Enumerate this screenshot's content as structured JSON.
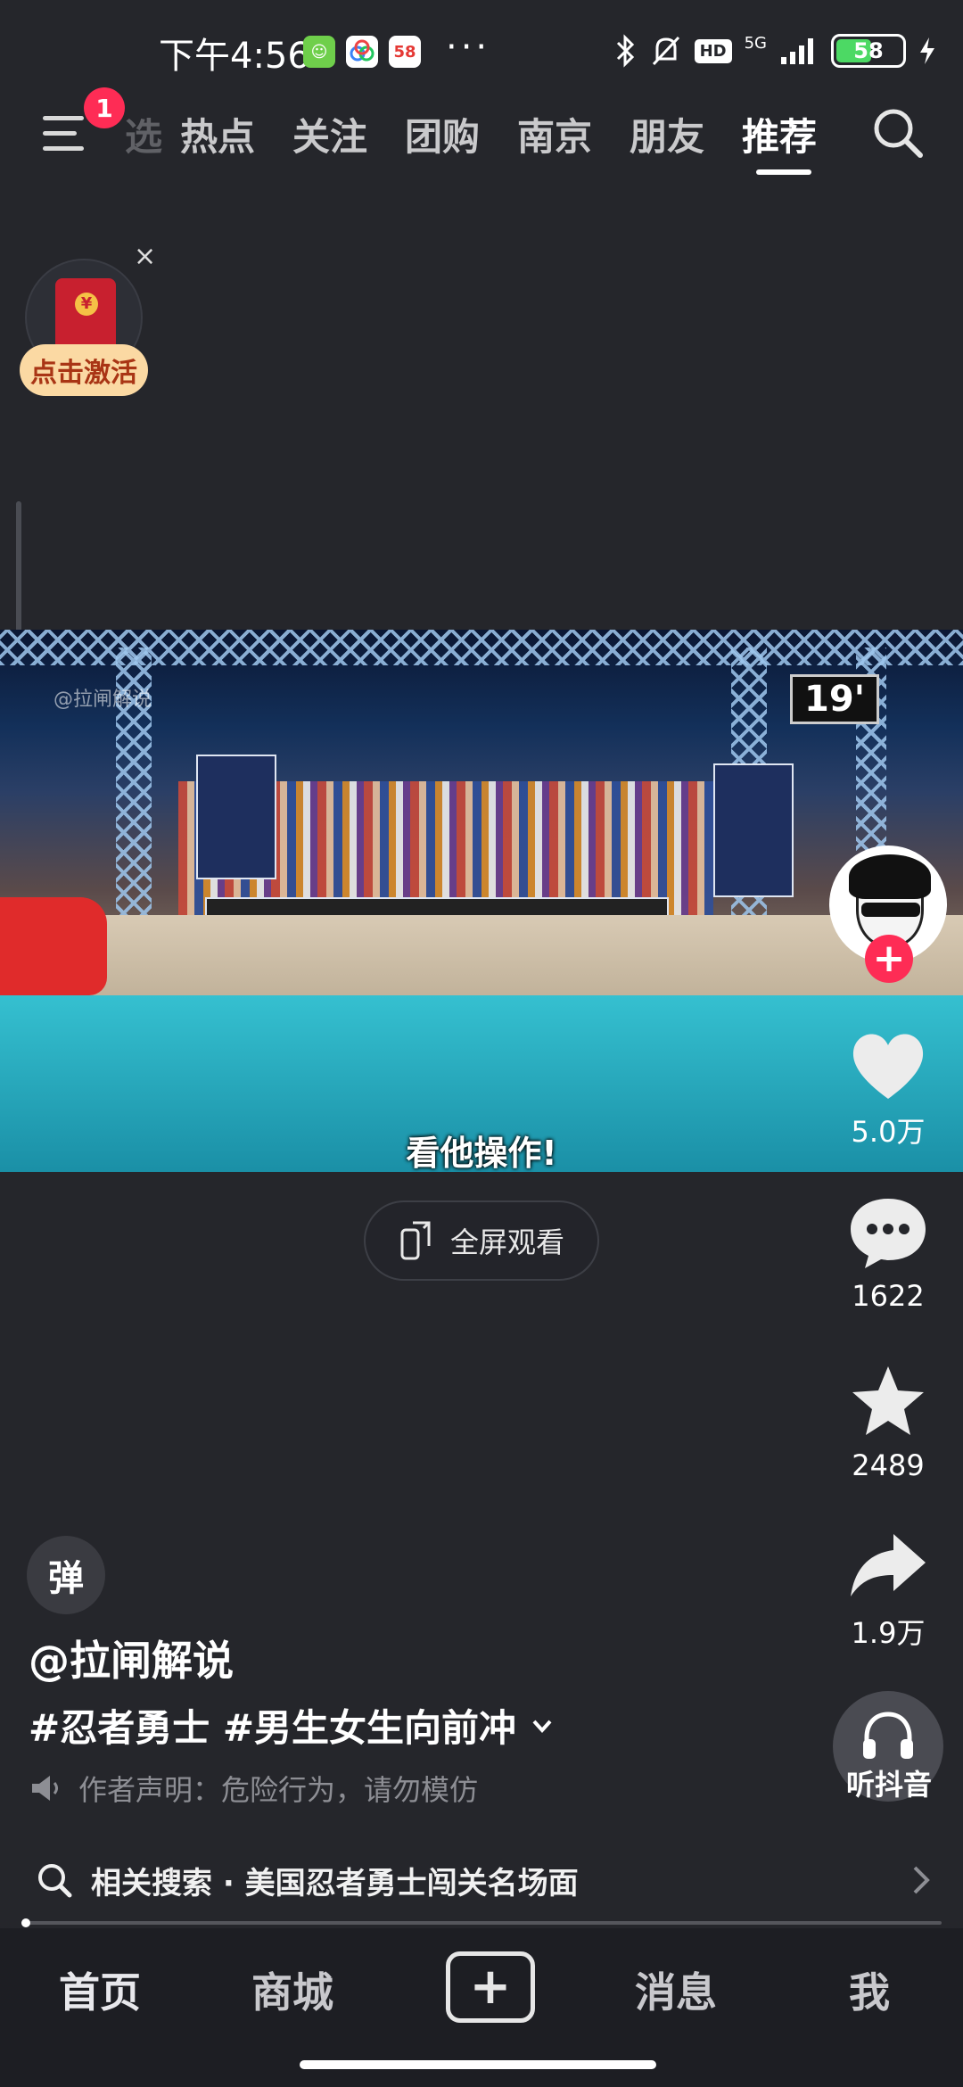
{
  "status_bar": {
    "time": "下午4:56",
    "apps": [
      "58"
    ],
    "dots": "···",
    "network": "5G",
    "hd": "HD",
    "battery": "58"
  },
  "top_nav": {
    "notification_count": "1",
    "partial_tab": "选",
    "tabs": [
      "热点",
      "关注",
      "团购",
      "南京",
      "朋友",
      "推荐"
    ],
    "active_tab": "推荐"
  },
  "red_envelope": {
    "close": "×",
    "cta": "点击激活"
  },
  "video": {
    "watermark": "@拉闸解说",
    "timer": "19'",
    "subtitle": "看他操作!",
    "fullscreen_label": "全屏观看"
  },
  "actions": {
    "follow": "+",
    "likes": "5.0万",
    "comments": "1622",
    "favorites": "2489",
    "shares": "1.9万",
    "listen_label": "听抖音"
  },
  "caption": {
    "danmu": "弹",
    "author": "@拉闸解说",
    "tags": "#忍者勇士 #男生女生向前冲",
    "notice": "作者声明：危险行为，请勿模仿"
  },
  "related_search": {
    "label": "相关搜索 · 美国忍者勇士闯关名场面"
  },
  "progress": {
    "fraction": 0.01
  },
  "bottom_nav": {
    "home": "首页",
    "mall": "商城",
    "create": "+",
    "messages": "消息",
    "me": "我"
  },
  "colors": {
    "background": "#25262b",
    "accent": "#fe2c55",
    "envelope_cta_bg": "#fbd9a3"
  },
  "icons": [
    "menu-icon",
    "search-icon",
    "heart-icon",
    "comment-icon",
    "star-icon",
    "share-icon",
    "headphones-icon",
    "speaker-icon",
    "chevron-right-icon",
    "chevron-down-icon",
    "fullscreen-icon",
    "bluetooth-icon",
    "bell-off-icon",
    "signal-icon",
    "charging-icon"
  ]
}
